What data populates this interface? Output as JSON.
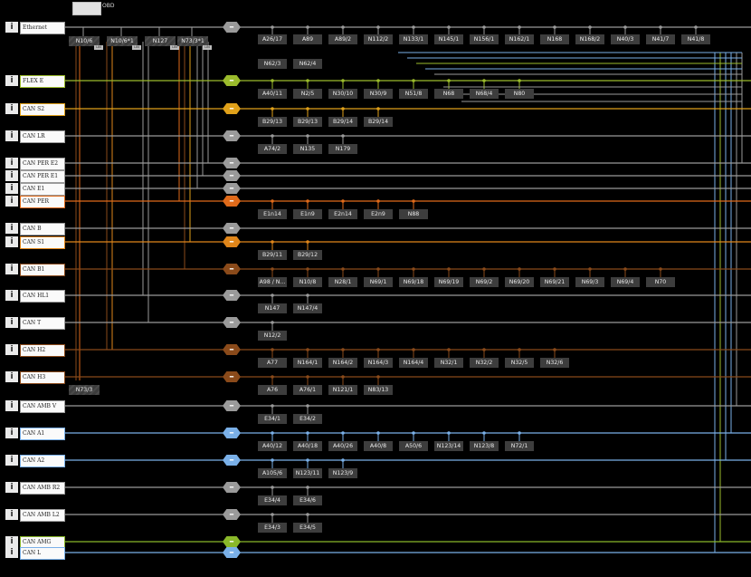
{
  "gateway": {
    "label": "OBD"
  },
  "colors": {
    "ethernet": "#9a9a9a",
    "flex": "#9bbb2c",
    "cans2": "#e0a11a",
    "canpe": "#e06a1a",
    "cans1": "#e0861a",
    "brown": "#8a4a1a",
    "gray": "#9a9a9a",
    "blue": "#7ab0e8",
    "amg": "#8ab82a",
    "ecu_bg": "#3d3d3d"
  },
  "buses": [
    {
      "id": "eth",
      "label": "Ethernet",
      "color": "gray",
      "toggle_symbol": "–",
      "nodes": [
        "A26/17",
        "A89",
        "A89/2",
        "N112/2",
        "N133/1",
        "N145/1",
        "N156/1",
        "N162/1",
        "N168",
        "N168/2",
        "N40/3",
        "N41/7",
        "N41/8"
      ],
      "nodes_row2": [
        "N62/3",
        "N62/4"
      ]
    },
    {
      "id": "flex",
      "label": "FLEX E",
      "color": "flex",
      "toggle_symbol": "–",
      "nodes": [
        "A40/11",
        "N2/5",
        "N30/10",
        "N30/9",
        "N51/8",
        "N68",
        "N68/4",
        "N80"
      ]
    },
    {
      "id": "s2",
      "label": "CAN S2",
      "color": "cans2",
      "toggle_symbol": "–",
      "nodes": [
        "B29/13",
        "B29/13",
        "B29/14",
        "B29/14"
      ]
    },
    {
      "id": "lr",
      "label": "CAN LR",
      "color": "gray",
      "toggle_symbol": "–",
      "nodes": [
        "A74/2",
        "N135",
        "N179"
      ]
    },
    {
      "id": "pere2",
      "label": "CAN PER E2",
      "color": "gray",
      "toggle_symbol": "–",
      "nodes": []
    },
    {
      "id": "pere1",
      "label": "CAN PER E1",
      "color": "gray",
      "toggle_symbol": "–",
      "nodes": []
    },
    {
      "id": "e1",
      "label": "CAN E1",
      "color": "gray",
      "toggle_symbol": "–",
      "nodes": []
    },
    {
      "id": "pe",
      "label": "CAN PER",
      "color": "canpe",
      "toggle_symbol": "–",
      "nodes": [
        "E1n14",
        "E1n9",
        "E2n14",
        "E2n9",
        "N88"
      ]
    },
    {
      "id": "b",
      "label": "CAN B",
      "color": "gray",
      "toggle_symbol": "–",
      "nodes": []
    },
    {
      "id": "s1",
      "label": "CAN S1",
      "color": "cans1",
      "toggle_symbol": "–",
      "nodes": [
        "B29/11",
        "B29/12"
      ]
    },
    {
      "id": "b1",
      "label": "CAN B1",
      "color": "brown",
      "toggle_symbol": "–",
      "nodes": [
        "A98 / N...",
        "N10/8",
        "N28/1",
        "N69/1",
        "N69/18",
        "N69/19",
        "N69/2",
        "N69/20",
        "N69/21",
        "N69/3",
        "N69/4",
        "N70"
      ]
    },
    {
      "id": "hl1",
      "label": "CAN HL1",
      "color": "gray",
      "toggle_symbol": "–",
      "nodes": [
        "N147",
        "N147/4"
      ]
    },
    {
      "id": "t",
      "label": "CAN T",
      "color": "gray",
      "toggle_symbol": "–",
      "nodes": [
        "N12/2"
      ]
    },
    {
      "id": "h2",
      "label": "CAN H2",
      "color": "brown",
      "toggle_symbol": "–",
      "nodes": [
        "A77",
        "N164/1",
        "N164/2",
        "N164/3",
        "N164/4",
        "N32/1",
        "N32/2",
        "N32/5",
        "N32/6"
      ]
    },
    {
      "id": "h3",
      "label": "CAN H3",
      "color": "brown",
      "toggle_symbol": "–",
      "nodes": [
        "A76",
        "A76/1",
        "N121/1",
        "N83/13"
      ]
    },
    {
      "id": "amb",
      "label": "CAN AMB V",
      "color": "gray",
      "toggle_symbol": "–",
      "nodes": [
        "E34/1",
        "E34/2"
      ]
    },
    {
      "id": "a1",
      "label": "CAN A1",
      "color": "blue",
      "toggle_symbol": "–",
      "nodes": [
        "A40/12",
        "A40/18",
        "A40/26",
        "A40/8",
        "A50/6",
        "N123/14",
        "N123/8",
        "N72/1"
      ]
    },
    {
      "id": "a2",
      "label": "CAN A2",
      "color": "blue",
      "toggle_symbol": "–",
      "nodes": [
        "A105/6",
        "N123/11",
        "N123/9"
      ]
    },
    {
      "id": "ambr2",
      "label": "CAN AMB R2",
      "color": "gray",
      "toggle_symbol": "–",
      "nodes": [
        "E34/4",
        "E34/6"
      ]
    },
    {
      "id": "ambl2",
      "label": "CAN AMB L2",
      "color": "gray",
      "toggle_symbol": "–",
      "nodes": [
        "E34/3",
        "E34/5"
      ]
    },
    {
      "id": "amg",
      "label": "CAN AMG",
      "color": "amg",
      "toggle_symbol": "–",
      "nodes": []
    },
    {
      "id": "l",
      "label": "CAN L",
      "color": "blue",
      "toggle_symbol": "–",
      "nodes": []
    }
  ],
  "gateways_top": [
    "N10/6",
    "N10/6*1",
    "N127",
    "N73/3*1"
  ],
  "gateway_bottom": "N73/3",
  "lin_badge": "LIN",
  "info_symbol": "i"
}
